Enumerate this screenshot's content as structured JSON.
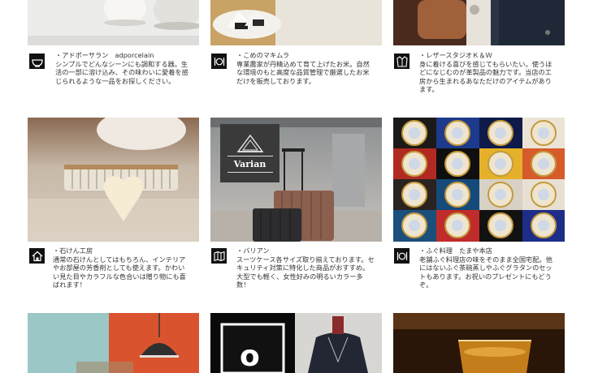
{
  "shops": [
    {
      "title": "・アドポーサラン　adporcelain",
      "desc": "シンプルでどんなシーンにも調和する器。生活の一部に溶け込み、その味わいに愛着を感じられるような一品をお探しください。",
      "icon": "bowl-icon"
    },
    {
      "title": "・こめのマキムラ",
      "desc": "専業農家が丹精込めて育て上げたお米。自然な環境のもと高度な品質管理で厳選したお米だけを販売しております。",
      "icon": "dining-icon"
    },
    {
      "title": "・レザースタジオＫ＆Ｗ",
      "desc": "身に着ける喜びを感じてもらいたい。使うほどになじむのが革製品の魅力です。当店の工房から生まれるあなただけのアイテムがあります。",
      "icon": "jacket-icon"
    },
    {
      "title": "・石けん工房",
      "desc": "通常の石けんとしてはもちろん、インテリアやお部屋の芳香剤としても使えます。かわいい見た目やカラフルな色合いは贈り物にも喜ばれます！",
      "icon": "house-icon"
    },
    {
      "title": "・バリアン",
      "desc": "スーツケース各サイズ取り揃えております。セキュリティ対策に特化した商品がおすすめ。大型でも軽く、女性好みの明るいカラー多数！",
      "icon": "map-icon",
      "logo": "Varian"
    },
    {
      "title": "・ふぐ料理　たまや本店",
      "desc": "老舗ふぐ料理店の味をそのまま全国宅配。他にはないふぐ茶碗蒸しやふぐグラタンのセットもあります。お祝いのプレゼントにもどうぞ。",
      "icon": "dining-icon"
    }
  ],
  "bottom_row": {
    "center_logo_letter": "o"
  }
}
